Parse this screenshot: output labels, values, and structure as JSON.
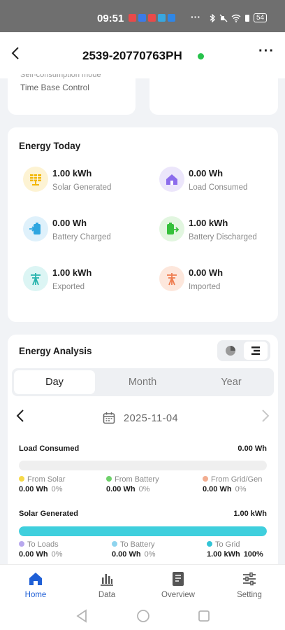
{
  "status_bar": {
    "time": "09:51",
    "more": "···",
    "battery": "54"
  },
  "header": {
    "title": "2539-20770763PH",
    "back_icon": "chevron-left-icon",
    "menu_icon": "more-horizontal-icon"
  },
  "top_card": {
    "cut_text": "Self-consumption mode",
    "time_base_control": "Time Base Control"
  },
  "energy_today": {
    "title": "Energy Today",
    "items": [
      {
        "value": "1.00 kWh",
        "label": "Solar Generated",
        "icon": "solar-panel-icon"
      },
      {
        "value": "0.00 Wh",
        "label": "Load Consumed",
        "icon": "house-icon"
      },
      {
        "value": "0.00 Wh",
        "label": "Battery Charged",
        "icon": "battery-charge-icon"
      },
      {
        "value": "1.00 kWh",
        "label": "Battery Discharged",
        "icon": "battery-discharge-icon"
      },
      {
        "value": "1.00 kWh",
        "label": "Exported",
        "icon": "grid-export-icon"
      },
      {
        "value": "0.00 Wh",
        "label": "Imported",
        "icon": "grid-import-icon"
      }
    ]
  },
  "energy_analysis": {
    "title": "Energy Analysis",
    "tabs": [
      "Day",
      "Month",
      "Year"
    ],
    "active_tab": "Day",
    "date": "2025-11-04",
    "load": {
      "title": "Load Consumed",
      "total": "0.00 Wh",
      "fill_fraction": 0,
      "legend": [
        {
          "name": "From Solar",
          "value": "0.00 Wh",
          "pct": "0%",
          "color": "#f6d94a"
        },
        {
          "name": "From Battery",
          "value": "0.00 Wh",
          "pct": "0%",
          "color": "#6fd16b"
        },
        {
          "name": "From Grid/Gen",
          "value": "0.00 Wh",
          "pct": "0%",
          "color": "#f2ad90"
        }
      ]
    },
    "solar": {
      "title": "Solar Generated",
      "total": "1.00 kWh",
      "fill_fraction": 1,
      "legend": [
        {
          "name": "To Loads",
          "value": "0.00 Wh",
          "pct": "0%",
          "color": "#b8a8ee"
        },
        {
          "name": "To Battery",
          "value": "0.00 Wh",
          "pct": "0%",
          "color": "#8fd4ee"
        },
        {
          "name": "To Grid",
          "value": "1.00 kWh",
          "pct": "100%",
          "color": "#32c4d6"
        }
      ]
    }
  },
  "bottom_nav": [
    {
      "label": "Home",
      "icon": "home-icon",
      "active": true
    },
    {
      "label": "Data",
      "icon": "bar-chart-icon",
      "active": false
    },
    {
      "label": "Overview",
      "icon": "document-icon",
      "active": false
    },
    {
      "label": "Setting",
      "icon": "sliders-icon",
      "active": false
    }
  ],
  "colors": {
    "accent": "#1f5fd6",
    "online": "#27c24c",
    "solar_bar": "#3fcfdd"
  }
}
